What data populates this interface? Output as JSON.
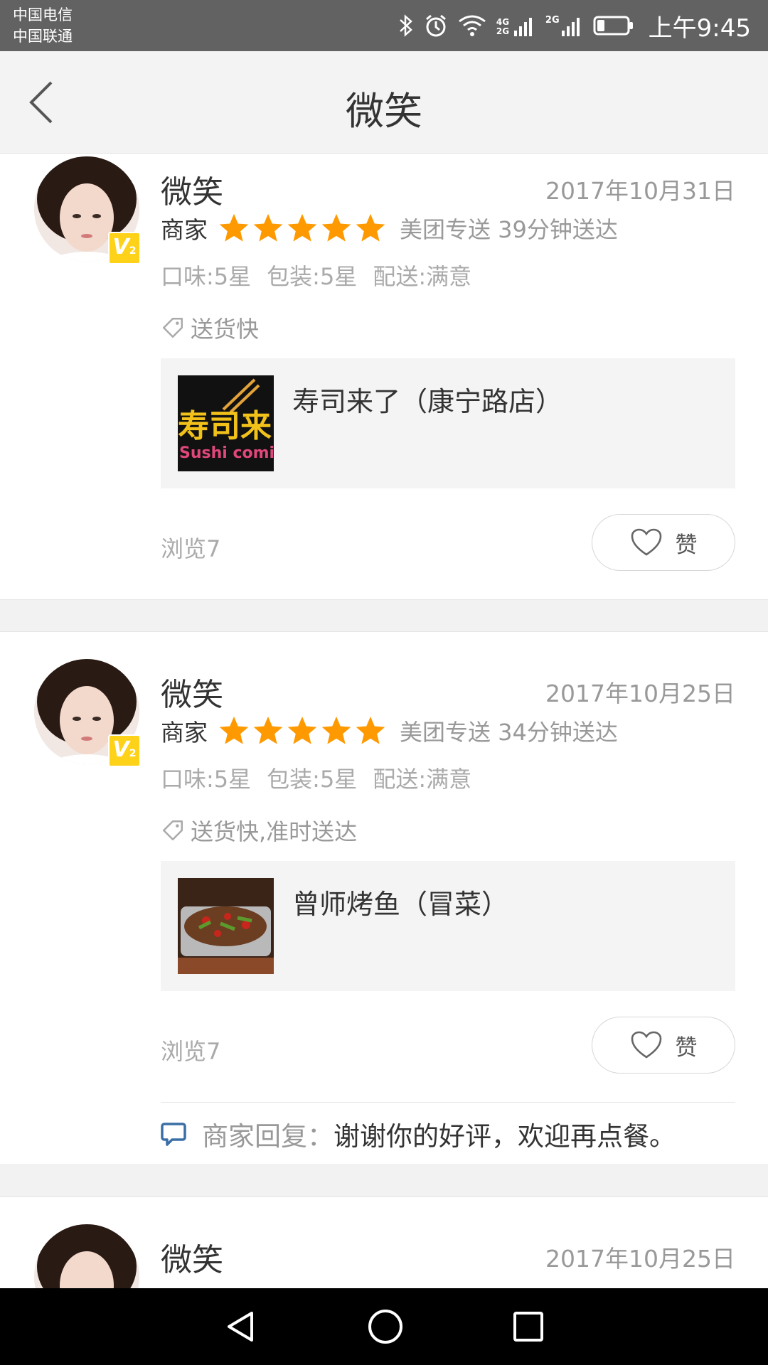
{
  "status_bar": {
    "carrier1": "中国电信",
    "carrier2": "中国联通",
    "network1": "4G 2G",
    "network2": "2G",
    "time": "上午9:45"
  },
  "header": {
    "title": "微笑"
  },
  "reviews": [
    {
      "username": "微笑",
      "date": "2017年10月31日",
      "merchant_label": "商家",
      "stars": 5,
      "delivery": "美团专送 39分钟送达",
      "taste": "口味:5星",
      "packaging": "包装:5星",
      "delivery_rating": "配送:满意",
      "tags": "送货快",
      "shop_name": "寿司来了（康宁路店）",
      "views": "浏览7",
      "like_label": "赞"
    },
    {
      "username": "微笑",
      "date": "2017年10月25日",
      "merchant_label": "商家",
      "stars": 5,
      "delivery": "美团专送 34分钟送达",
      "taste": "口味:5星",
      "packaging": "包装:5星",
      "delivery_rating": "配送:满意",
      "tags": "送货快,准时送达",
      "shop_name": "曾师烤鱼（冒菜）",
      "views": "浏览7",
      "like_label": "赞",
      "reply_label": "商家回复：",
      "reply_text": "谢谢你的好评，欢迎再点餐。"
    },
    {
      "username": "微笑",
      "date": "2017年10月25日"
    }
  ],
  "logo_text": {
    "sushi_cn": "寿司来了",
    "sushi_en": "Sushi coming"
  },
  "colors": {
    "star": "#ff9900",
    "reply_icon": "#3a6ea5",
    "vip_badge": "#ffd21a"
  }
}
